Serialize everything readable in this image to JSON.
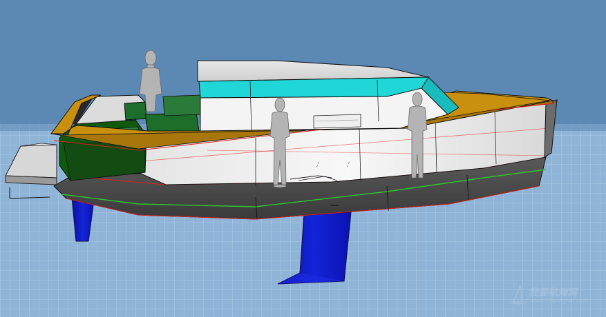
{
  "scene": {
    "subject": "3D hull model with cabin on grid plane",
    "colors": {
      "background": "#5b89b3",
      "grid_fill": "#8fb4d8",
      "grid_line": "#b7d0e8",
      "deck": "#c8900e",
      "cockpit_green": "#0f5a0f",
      "canopy_glass": "#21d6d6",
      "hull_white": "#f2f2f2",
      "hull_dark": "#4a4a4a",
      "foil_blue": "#0b16c0",
      "figure_grey": "#b4b4b4",
      "outline_red": "#e0201a",
      "waterline_green": "#2fc82f"
    }
  },
  "watermark": {
    "title": "我要航海网",
    "url": "www.51hanghai.com"
  }
}
